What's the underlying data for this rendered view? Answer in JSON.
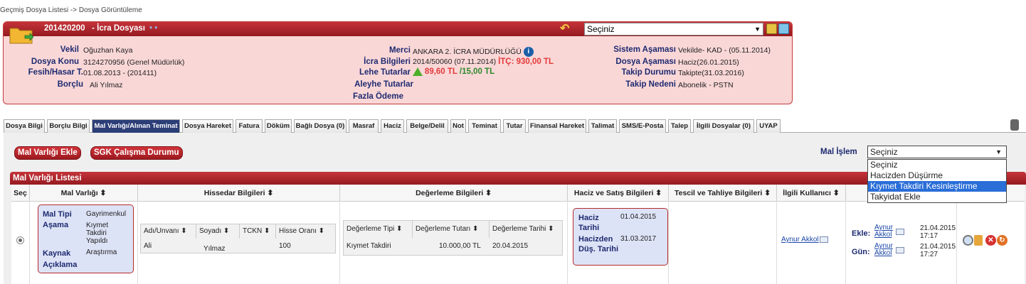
{
  "breadcrumb": "Geçmiş Dosya Listesi -> Dosya Görüntüleme",
  "file": {
    "number": "201420200",
    "title": "- İcra Dosyası",
    "dots": "• •",
    "header_select": "Seçiniz",
    "fields_left": [
      {
        "label": "Vekil",
        "value": "Oğuzhan Kaya"
      },
      {
        "label": "Dosya Konu",
        "value": "3124270956 (Genel Müdürlük)"
      },
      {
        "label": "Fesih/Hasar T.",
        "value": "01.08.2013 - (201411)"
      },
      {
        "label": "Borçlu",
        "value": "Ali Yılmaz"
      }
    ],
    "merci": {
      "label": "Merci",
      "value": "ANKARA 2. İCRA MÜDÜRLÜĞÜ"
    },
    "icra": {
      "label": "İcra Bilgileri",
      "value": "2014/50060 (07.11.2014)",
      "itc": "İTÇ: 930,00 TL"
    },
    "lehe": {
      "label": "Lehe Tutarlar",
      "value_red": "89,60 TL",
      "value_green": "/15,00 TL"
    },
    "aleyhe_label": "Aleyhe Tutarlar",
    "fazla_label": "Fazla Ödeme",
    "fields_right": [
      {
        "label": "Sistem Aşaması",
        "value": "Vekilde- KAD - (05.11.2014)"
      },
      {
        "label": "Dosya Aşaması",
        "value": "Haciz(26.01.2015)"
      },
      {
        "label": "Takip Durumu",
        "value": "Takipte(31.03.2016)"
      },
      {
        "label": "Takip Nedeni",
        "value": "Abonelik - PSTN"
      }
    ]
  },
  "tabs": [
    "Dosya Bilgi",
    "Borçlu Bilgi",
    "Mal Varlığı/Alınan Teminat",
    "Dosya Hareket",
    "Fatura",
    "Döküm",
    "Bağlı Dosya (0)",
    "Masraf",
    "Haciz",
    "Belge/Delil",
    "Not",
    "Teminat",
    "Tutar",
    "Finansal Hareket",
    "Talimat",
    "SMS/E-Posta",
    "Talep",
    "İlgili Dosyalar (0)",
    "UYAP"
  ],
  "buttons": {
    "add_asset": "Mal Varlığı Ekle",
    "sgk": "SGK Çalışma Durumu"
  },
  "mal_islem": {
    "label": "Mal İşlem",
    "selected": "Seçiniz",
    "options": [
      "Seçiniz",
      "Hacizden Düşürme",
      "Kıymet Takdiri Kesinleştirme",
      "Takyidat Ekle"
    ],
    "highlighted": "Kıymet Takdiri Kesinleştirme"
  },
  "list": {
    "title": "Mal Varlığı Listesi",
    "headers": [
      "Seç",
      "Mal Varlığı ⬍",
      "Hissedar Bilgileri ⬍",
      "Değerleme Bilgileri ⬍",
      "Haciz ve Satış Bilgileri ⬍",
      "Tescil ve Tahliye Bilgileri ⬍",
      "İlgili Kullanıcı ⬍"
    ],
    "row": {
      "mal_tipi_label": "Mal Tipi",
      "mal_tipi": "Gayrimenkul",
      "asama_label": "Aşama",
      "asama": "Kıymet Takdiri Yapıldı",
      "kaynak_label": "Kaynak",
      "kaynak": "Araştırma",
      "aciklama_label": "Açıklama",
      "hissedar_headers": [
        "Adı/Unvanı ⬍",
        "Soyadı ⬍",
        "TCKN ⬍",
        "Hisse Oranı ⬍"
      ],
      "hissedar_values": [
        "Ali",
        "Yılmaz",
        "",
        "100"
      ],
      "degerleme_headers": [
        "Değerleme Tipi ⬍",
        "Değerleme Tutarı ⬍",
        "Değerleme Tarihi ⬍"
      ],
      "degerleme_values": [
        "Kıymet Takdiri",
        "10.000,00 TL",
        "20.04.2015"
      ],
      "haciz_tarihi_label": "Haciz Tarihi",
      "haciz_tarihi": "01.04.2015",
      "hacizden_dus_label": "Hacizden Düş. Tarihi",
      "hacizden_dus": "31.03.2017",
      "user": "Aynur Akkol",
      "ekle_label": "Ekle:",
      "ekle_user": "Aynur Akkol",
      "ekle_date": "21.04.2015 17:17",
      "gun_label": "Gün:",
      "gun_user": "Aynur Akkol",
      "gun_date": "21.04.2015 17:27"
    }
  }
}
